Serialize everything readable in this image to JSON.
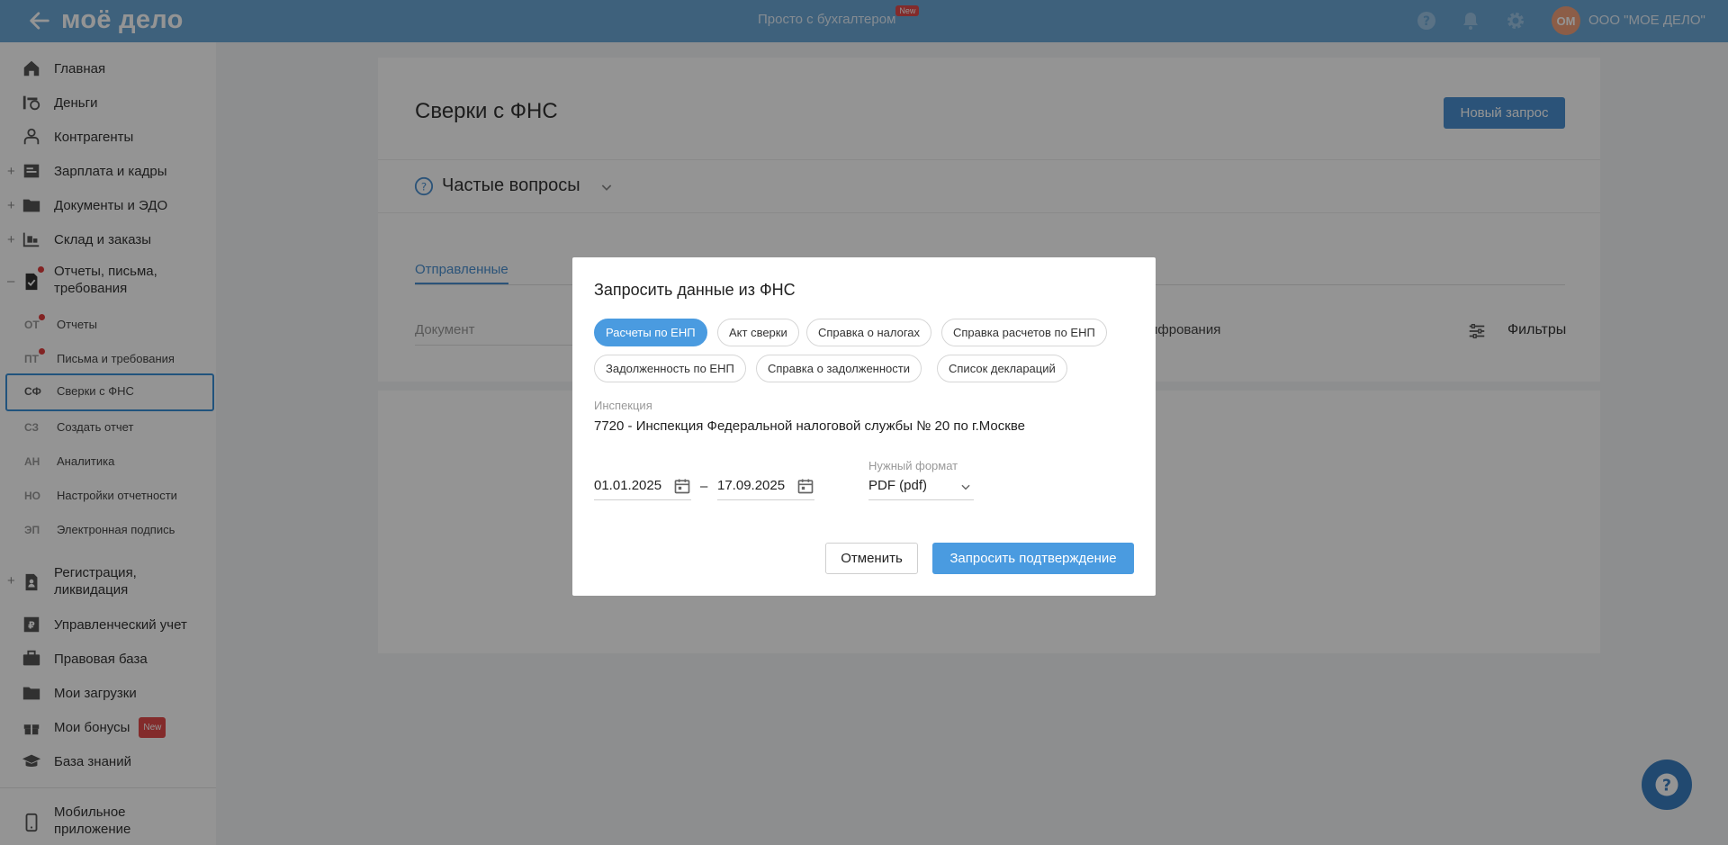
{
  "topbar": {
    "logo": "моё дело",
    "center_link": "Просто с бухгалтером",
    "center_badge": "New",
    "avatar_initials": "ОМ",
    "org_name": "ООО \"МОЕ ДЕЛО\""
  },
  "sidebar": {
    "items": [
      {
        "label": "Главная",
        "icon": "home-icon"
      },
      {
        "label": "Деньги",
        "icon": "money-icon"
      },
      {
        "label": "Контрагенты",
        "icon": "contractors-icon"
      },
      {
        "label": "Зарплата и кадры",
        "icon": "payroll-icon"
      },
      {
        "label": "Документы и ЭДО",
        "icon": "folder-icon"
      },
      {
        "label": "Склад и заказы",
        "icon": "warehouse-icon"
      },
      {
        "label": "Отчеты, письма,\nтребования",
        "icon": "reports-icon"
      },
      {
        "label": "Регистрация,\nликвидация",
        "icon": "registration-icon"
      },
      {
        "label": "Управленческий учет",
        "icon": "management-icon"
      },
      {
        "label": "Правовая база",
        "icon": "briefcase-icon"
      },
      {
        "label": "Мои загрузки",
        "icon": "folder-icon"
      },
      {
        "label": "Мои бонусы",
        "icon": "gift-icon",
        "badge": "New"
      },
      {
        "label": "База знаний",
        "icon": "graduation-icon"
      },
      {
        "label": "Мобильное\nприложение",
        "icon": "mobile-icon"
      }
    ],
    "sub_items": [
      {
        "abbr": "ОТ",
        "label": "Отчеты"
      },
      {
        "abbr": "ПТ",
        "label": "Письма и требования"
      },
      {
        "abbr": "СФ",
        "label": "Сверки с ФНС"
      },
      {
        "abbr": "СЗ",
        "label": "Создать отчет"
      },
      {
        "abbr": "АН",
        "label": "Аналитика"
      },
      {
        "abbr": "НО",
        "label": "Настройки отчетности"
      },
      {
        "abbr": "ЭП",
        "label": "Электронная подпись"
      }
    ]
  },
  "main": {
    "title": "Сверки с ФНС",
    "new_request_button": "Новый запрос",
    "faq_title": "Частые вопросы",
    "tab_sent": "Отправленные",
    "col_document": "Документ",
    "col_decrypt": "ифрования",
    "filters_label": "Фильтры"
  },
  "modal": {
    "title": "Запросить данные из ФНС",
    "chips": [
      {
        "label": "Расчеты по ЕНП",
        "active": true
      },
      {
        "label": "Акт сверки",
        "active": false
      },
      {
        "label": "Справка о налогах",
        "active": false
      },
      {
        "label": "Справка расчетов по ЕНП",
        "active": false
      },
      {
        "label": "Задолженность по ЕНП",
        "active": false
      },
      {
        "label": "Справка о задолженности",
        "active": false
      },
      {
        "label": "Список деклараций",
        "active": false
      }
    ],
    "inspection_label": "Инспекция",
    "inspection_value": "7720 - Инспекция Федеральной налоговой службы № 20 по г.Москве",
    "date_from": "01.01.2025",
    "date_dash": "–",
    "date_to": "17.09.2025",
    "format_label": "Нужный формат",
    "format_value": "PDF (pdf)",
    "cancel_button": "Отменить",
    "request_button": "Запросить подтверждение"
  },
  "colors": {
    "topbar": "#6ca8d6",
    "accent": "#4a9be0",
    "badge_red": "#e24a4a"
  }
}
